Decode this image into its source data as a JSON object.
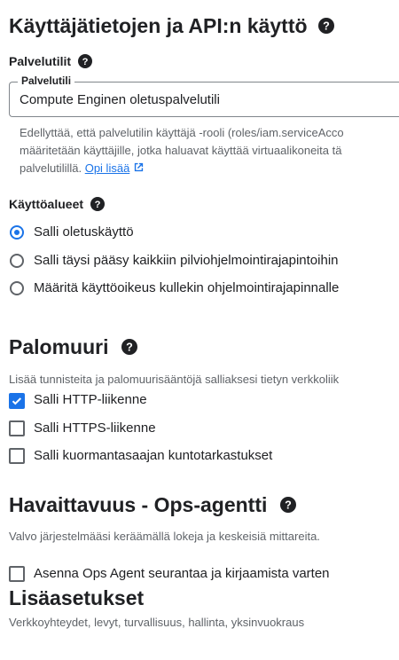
{
  "service_access": {
    "title": "Käyttäjätietojen ja API:n käyttö",
    "service_accounts_label": "Palvelutilit",
    "field": {
      "label": "Palvelutili",
      "value": "Compute Enginen oletuspalvelutili"
    },
    "desc_lines": [
      "Edellyttää, että palvelutilin käyttäjä -rooli (roles/iam.serviceAcco",
      "määritetään käyttäjille, jotka haluavat käyttää virtuaalikoneita tä",
      "palvelutilillä."
    ],
    "learn_more": "Opi lisää",
    "scopes_label": "Käyttöalueet",
    "scopes": [
      {
        "label": "Salli oletuskäyttö",
        "selected": true
      },
      {
        "label": "Salli täysi pääsy kaikkiin pilviohjelmointirajapintoihin",
        "selected": false
      },
      {
        "label": "Määritä käyttöoikeus kullekin ohjelmointirajapinnalle",
        "selected": false
      }
    ]
  },
  "firewall": {
    "title": "Palomuuri",
    "desc": "Lisää tunnisteita ja palomuurisääntöjä salliaksesi tietyn verkkoliik",
    "options": [
      {
        "label": "Salli HTTP-liikenne",
        "checked": true
      },
      {
        "label": "Salli HTTPS-liikenne",
        "checked": false
      },
      {
        "label": "Salli kuormantasaajan kuntotarkastukset",
        "checked": false
      }
    ]
  },
  "observability": {
    "title": "Havaittavuus - Ops-agentti",
    "desc": "Valvo järjestelmääsi keräämällä lokeja ja keskeisiä mittareita.",
    "option": {
      "label": "Asenna Ops Agent seurantaa ja kirjaamista varten",
      "checked": false
    }
  },
  "advanced": {
    "title": "Lisäasetukset",
    "desc": "Verkkoyhteydet, levyt, turvallisuus, hallinta, yksinvuokraus"
  },
  "colors": {
    "accent": "#1a73e8",
    "text": "#202124",
    "secondary": "#5f6368"
  },
  "icons": [
    "help-icon",
    "external-link-icon",
    "check-icon"
  ]
}
